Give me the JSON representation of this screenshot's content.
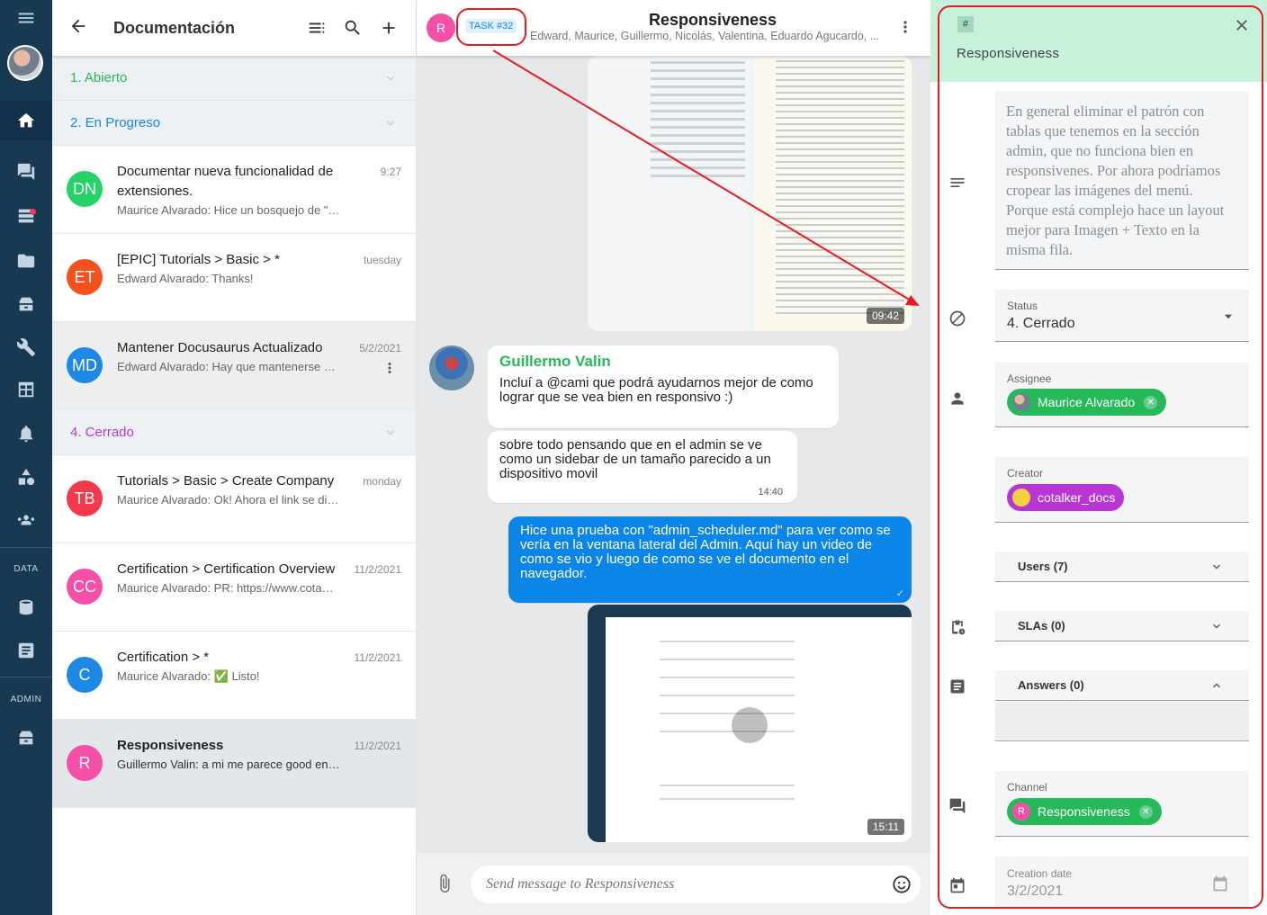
{
  "sidebar": {
    "data_label": "DATA",
    "admin_label": "ADMIN",
    "icons": [
      "menu-icon",
      "home-icon",
      "chat-icon",
      "tasks-icon",
      "folder-icon",
      "inventory-icon",
      "wrench-icon",
      "table-icon",
      "bell-icon",
      "shapes-icon",
      "people-icon",
      "database-icon",
      "form-icon",
      "admin-icon"
    ]
  },
  "list": {
    "title": "Documentación",
    "groups": {
      "open": {
        "label": "1. Abierto",
        "color": "#25b95a"
      },
      "progress": {
        "label": "2. En Progreso",
        "color": "#1687e8"
      },
      "closed": {
        "label": "4. Cerrado",
        "color": "#b936d6"
      }
    },
    "items": [
      {
        "initials": "DN",
        "color": "#25d366",
        "name": "Documentar nueva funcionalidad de extensiones.",
        "time": "9:27",
        "preview": "Maurice Alvarado: Hice un bosquejo de \"Upd…"
      },
      {
        "initials": "ET",
        "color": "#f4511e",
        "name": "[EPIC] Tutorials > Basic > *",
        "time": "tuesday",
        "preview": "Edward Alvarado: Thanks!"
      },
      {
        "initials": "MD",
        "color": "#1e88e5",
        "name": "Mantener Docusaurus Actualizado",
        "time": "5/2/2021",
        "preview": "Edward Alvarado: Hay que mantenerse at…"
      },
      {
        "initials": "TB",
        "color": "#f23a4c",
        "name": "Tutorials > Basic > Create Company",
        "time": "monday",
        "preview": "Maurice Alvarado: Ok! Ahora el link se dirig…"
      },
      {
        "initials": "CC",
        "color": "#f54fa8",
        "name": "Certification > Certification Overview",
        "time": "11/2/2021",
        "preview": "Maurice Alvarado: PR:  https://www.cota…"
      },
      {
        "initials": "C",
        "color": "#1e88e5",
        "name": "Certification > *",
        "time": "11/2/2021",
        "preview": "Maurice Alvarado: ✅ Listo!"
      },
      {
        "initials": "R",
        "color": "#f54fa8",
        "name": "Responsiveness",
        "time": "11/2/2021",
        "preview": "Guillermo Valin: a mi me parece good en…"
      }
    ]
  },
  "chat": {
    "avatar_initial": "R",
    "task_tag": "TASK #32",
    "title": "Responsiveness",
    "participants": "Edward, Maurice, Guillermo, Nicolás, Valentina, Eduardo Agucardo, ...",
    "image1_time": "09:42",
    "sender_name": "Guillermo Valin",
    "msg1": "Incluí a @cami que podrá ayudarnos mejor de como lograr que se vea bien en responsivo :)",
    "msg2": "sobre todo pensando que en el admin se ve como un sidebar de un tamaño parecido a un dispositivo movil",
    "msg2_time": "14:40",
    "msg3": "Hice una prueba con \"admin_scheduler.md\" para ver como se vería en la ventana lateral del Admin. Aquí hay un video de como se vio y luego de como se ve el documento en el navegador.",
    "msg3_check": "✓",
    "video_time": "15:11",
    "composer_placeholder": "Send message to Responsiveness"
  },
  "panel": {
    "hash": "#",
    "title": "Responsiveness",
    "description": "En general eliminar el patrón con tablas que tenemos en la sección admin, que no funciona bien en responsivenes. Por ahora podríamos cropear las imágenes del menú. Porque está complejo hace un layout mejor para Imagen + Texto en la misma fila.",
    "status_label": "Status",
    "status_value": "4. Cerrado",
    "assignee_label": "Assignee",
    "assignee_value": "Maurice Alvarado",
    "assignee_color": "#25b95a",
    "creator_label": "Creator",
    "creator_value": "cotalker_docs",
    "creator_color": "#b936d6",
    "users_label": "Users (7)",
    "slas_label": "SLAs (0)",
    "answers_label": "Answers (0)",
    "channel_label": "Channel",
    "channel_value": "Responsiveness",
    "channel_initial": "R",
    "creation_label": "Creation date",
    "creation_value": "3/2/2021"
  },
  "colors": {
    "rail": "#173a52",
    "accent_blue": "#0b86e8",
    "annotation_red": "#e51c23",
    "panel_header": "#c8f1dc"
  }
}
